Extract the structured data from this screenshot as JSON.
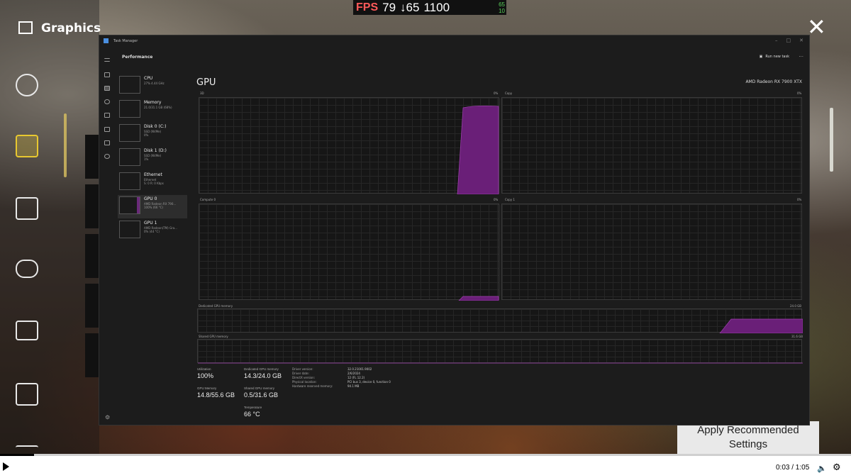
{
  "overlay": {
    "fps_label": "FPS",
    "fps_value": "79",
    "low_value": "↓65",
    "high_value": "1100",
    "mini_top": "65",
    "mini_bottom": "10"
  },
  "game_menu": {
    "section_title": "Graphics",
    "apply_button": "Apply Recommended Settings",
    "icons": [
      "graphics-icon",
      "audio-icon",
      "display-icon",
      "controller-icon",
      "subtitles-icon",
      "accessibility-icon",
      "more-icon"
    ]
  },
  "task_manager": {
    "window_title": "Task Manager",
    "page_title": "Performance",
    "run_new_task": "Run new task",
    "resources": [
      {
        "name": "CPU",
        "sub": "27% 4.44 GHz"
      },
      {
        "name": "Memory",
        "sub": "21.0/31.1 GB (68%)"
      },
      {
        "name": "Disk 0 (C:)",
        "sub": "SSD (NVMe)\n0%"
      },
      {
        "name": "Disk 1 (D:)",
        "sub": "SSD (NVMe)\n1%"
      },
      {
        "name": "Ethernet",
        "sub": "Ethernet\nS: 0 R: 0 Kbps"
      },
      {
        "name": "GPU 0",
        "sub": "AMD Radeon RX 790...\n100% (66 °C)"
      },
      {
        "name": "GPU 1",
        "sub": "AMD Radeon(TM) Gra...\n0% (44 °C)"
      }
    ],
    "gpu_heading": "GPU",
    "gpu_model": "AMD Radeon RX 7900 XTX",
    "graphs": {
      "g3d_label": "3D",
      "g3d_pct": "0%",
      "copy_label": "Copy",
      "copy_pct": "0%",
      "compute_label": "Compute 0",
      "compute_pct": "0%",
      "copy1_label": "Copy 1",
      "copy1_pct": "0%",
      "dedicated_label": "Dedicated GPU memory",
      "dedicated_max": "24.0 GB",
      "shared_label": "Shared GPU memory",
      "shared_max": "31.6 GB"
    },
    "stats": {
      "utilization_label": "Utilization",
      "utilization_value": "100%",
      "gpu_memory_label": "GPU Memory",
      "gpu_memory_value": "14.8/55.6 GB",
      "dedicated_label": "Dedicated GPU memory",
      "dedicated_value": "14.3/24.0 GB",
      "shared_label": "Shared GPU memory",
      "shared_value": "0.5/31.6 GB",
      "temperature_label": "Temperature",
      "temperature_value": "66 °C"
    },
    "info": {
      "labels": [
        "Driver version:",
        "Driver date:",
        "DirectX version:",
        "Physical location:",
        "Hardware reserved memory:"
      ],
      "values": [
        "32.0.21001.9002",
        "2/6/2024",
        "12 (FL 12.2)",
        "PCI bus 3, device 0, function 0",
        "94.1 MB"
      ]
    }
  },
  "video": {
    "time": "0:03 / 1:05",
    "progress_fraction": 0.04
  }
}
